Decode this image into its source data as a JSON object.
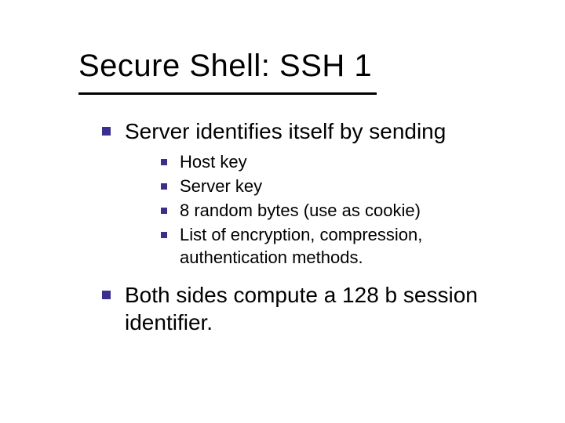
{
  "title": "Secure Shell: SSH 1",
  "bullets": [
    {
      "text": "Server identifies itself by sending",
      "children": [
        "Host key",
        "Server key",
        "8 random bytes (use as cookie)",
        "List of encryption, compression, authentication methods."
      ]
    },
    {
      "text": "Both sides compute a 128 b session identifier.",
      "children": []
    }
  ],
  "colors": {
    "bullet": "#3a2f8f",
    "text": "#000000",
    "background": "#ffffff"
  }
}
